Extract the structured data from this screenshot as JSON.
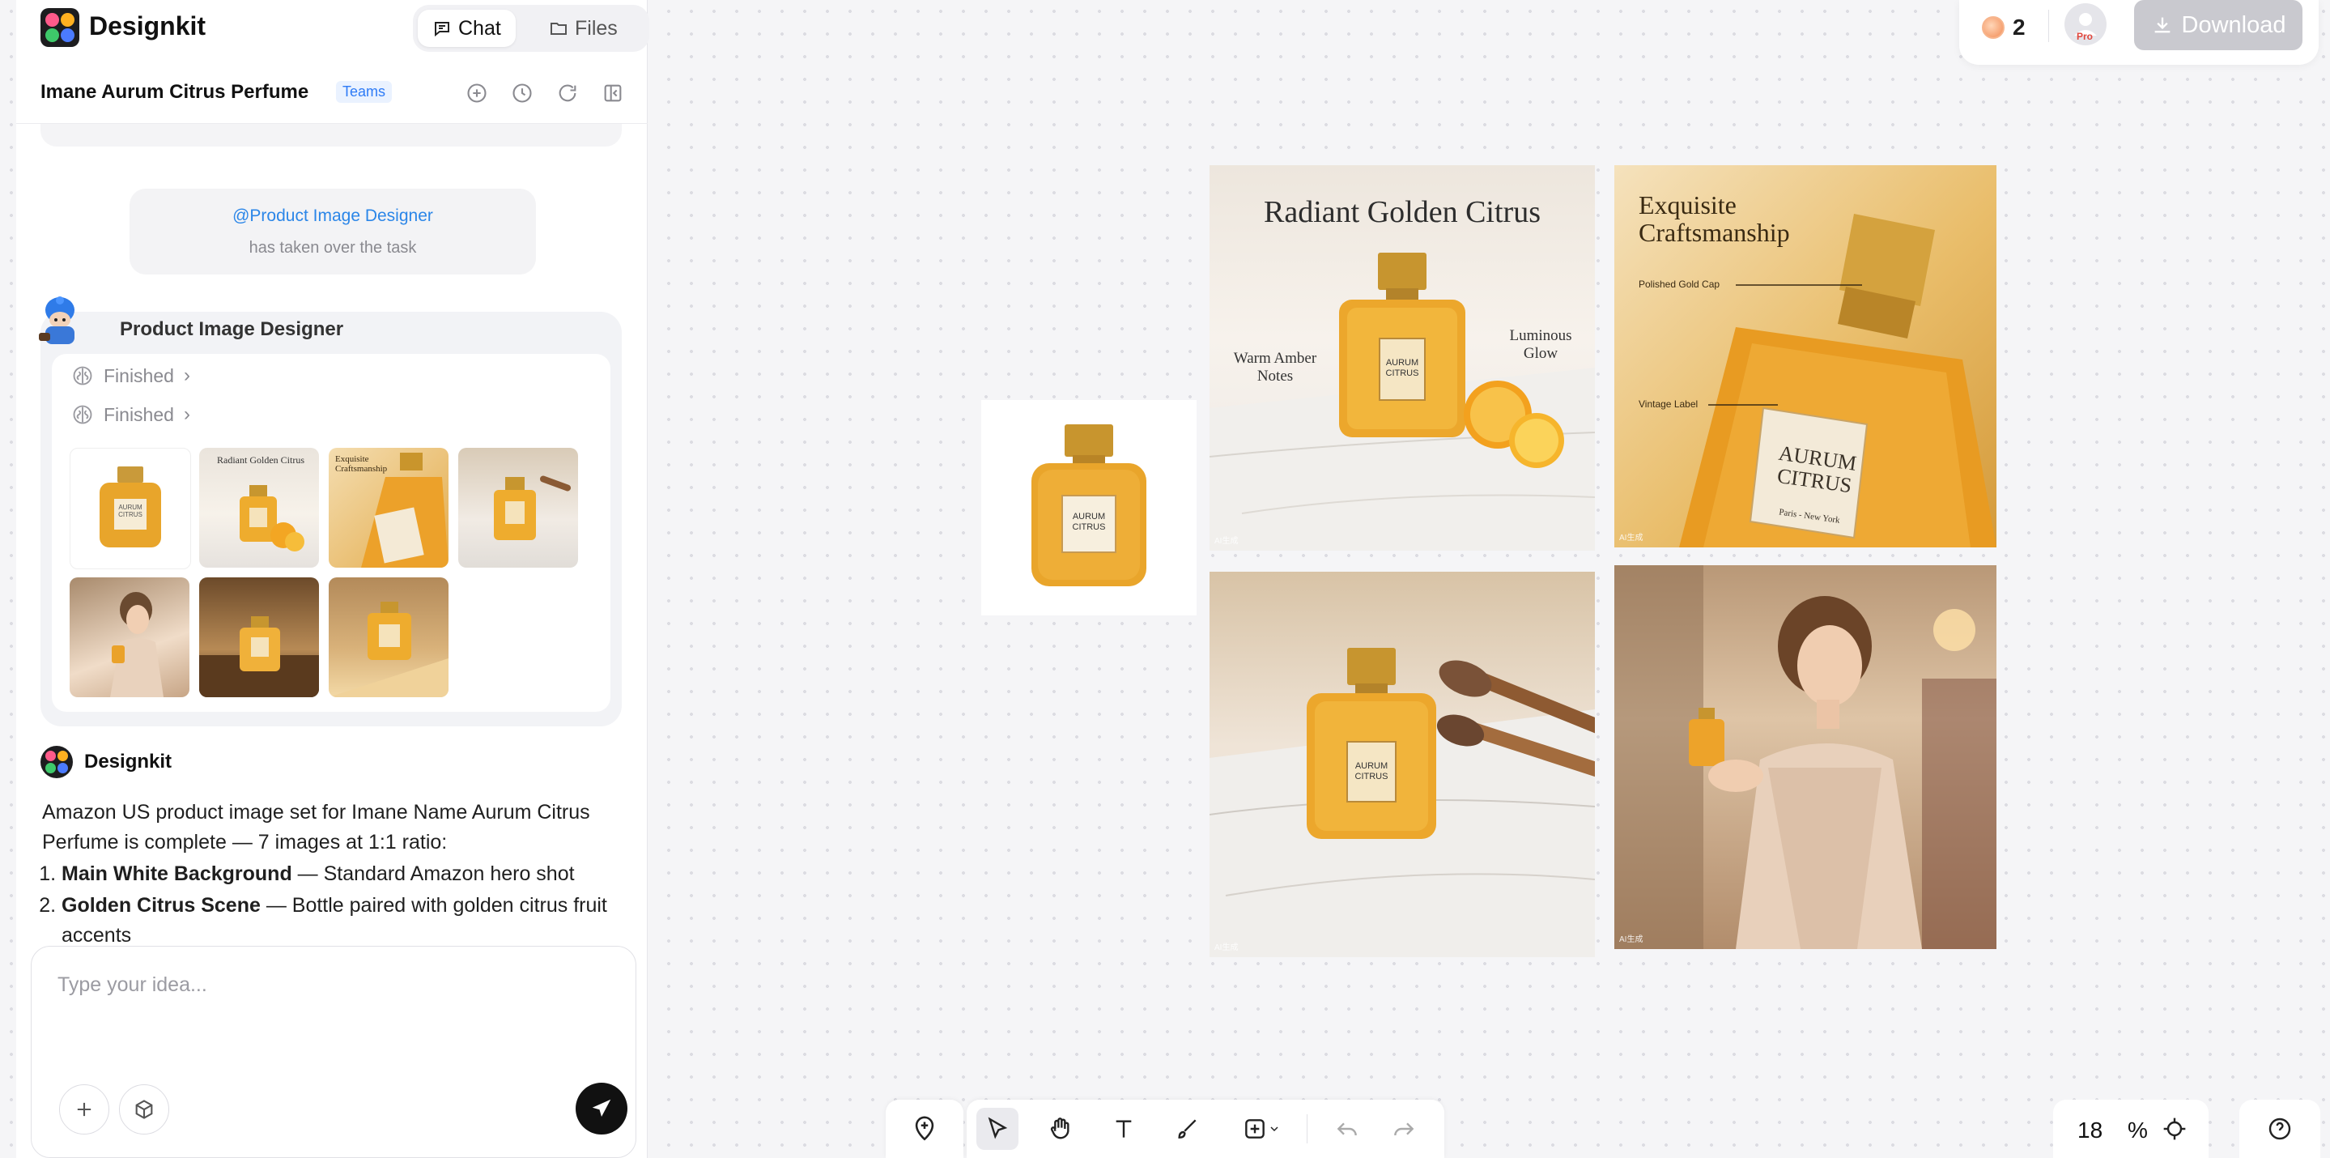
{
  "app": {
    "brand": "Designkit",
    "tabs": [
      {
        "label": "Chat"
      },
      {
        "label": "Files"
      }
    ]
  },
  "project": {
    "title": "Imane Aurum Citrus Perfume",
    "badge": "Teams"
  },
  "chat": {
    "takeover_mention": "@Product Image Designer",
    "takeover_text": "has taken over the task",
    "agent_name": "Product Image Designer",
    "status_rows": [
      {
        "label": "Finished"
      },
      {
        "label": "Finished"
      }
    ],
    "assistant_name": "Designkit",
    "message_intro": "Amazon US product image set for Imane Name Aurum Citrus Perfume is complete — 7 images at 1:1 ratio:",
    "message_items": [
      {
        "bold": "Main White Background",
        "rest": " — Standard Amazon hero shot"
      },
      {
        "bold": "Golden Citrus Scene",
        "rest": " — Bottle paired with golden citrus fruit accents"
      }
    ],
    "input_placeholder": "Type your idea..."
  },
  "thumbs": [
    {
      "label": "AURUM CITRUS"
    },
    {
      "label": "Radiant Golden Citrus"
    },
    {
      "label": "Exquisite Craftsmanship"
    },
    {
      "label": ""
    },
    {
      "label": ""
    },
    {
      "label": ""
    },
    {
      "label": ""
    }
  ],
  "topright": {
    "credits": "2",
    "pro_label": "Pro",
    "download_label": "Download"
  },
  "canvas": {
    "images": {
      "white": {
        "bottle_label_1": "AURUM",
        "bottle_label_2": "CITRUS"
      },
      "radiant": {
        "title": "Radiant Golden Citrus",
        "callout_left_1": "Warm Amber",
        "callout_left_2": "Notes",
        "callout_right_1": "Luminous",
        "callout_right_2": "Glow",
        "bottle_label_1": "AURUM",
        "bottle_label_2": "CITRUS",
        "ai_mark": "AI生成"
      },
      "craft": {
        "title_1": "Exquisite",
        "title_2": "Craftsmanship",
        "callout_1": "Polished Gold Cap",
        "callout_2": "Vintage Label",
        "bottle_label_1": "AURUM",
        "bottle_label_2": "CITRUS",
        "bottle_label_3": "Paris - New York",
        "ai_mark": "AI生成"
      },
      "marble": {
        "bottle_label_1": "AURUM",
        "bottle_label_2": "CITRUS",
        "ai_mark": "AI生成"
      },
      "lifestyle": {
        "ai_mark": "AI生成"
      }
    }
  },
  "zoom": {
    "value": "18",
    "unit": "%"
  },
  "colors": {
    "accent_blue": "#2b86e8",
    "dark": "#1d1d1f",
    "gold": "#e0a52a"
  }
}
